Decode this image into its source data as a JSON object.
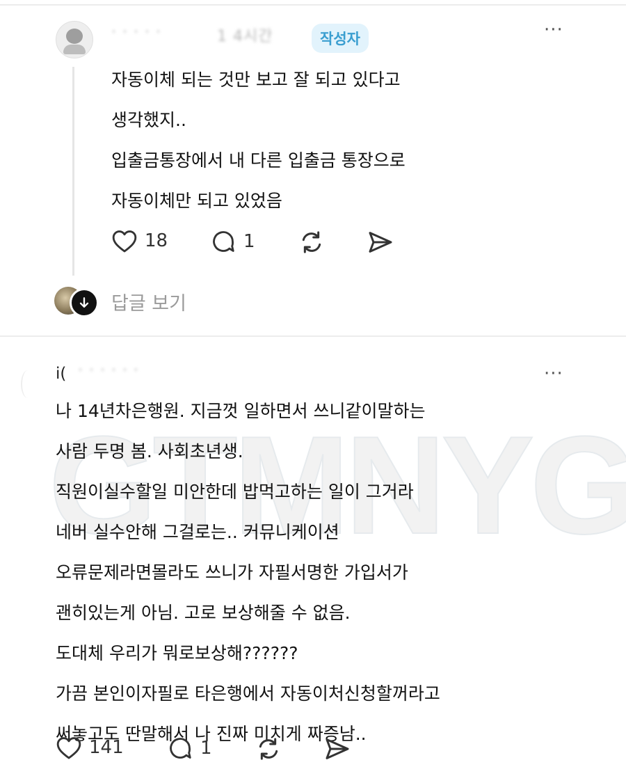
{
  "comment1": {
    "username": "·  · · · ·",
    "time": "1 4시간",
    "badge": "작성자",
    "more": "···",
    "lines": [
      "자동이체 되는 것만 보고 잘 되고 있다고",
      "생각했지..",
      "입출금통장에서 내 다른 입출금 통장으로",
      "자동이체만 되고 있었음"
    ],
    "likes": "18",
    "replies": "1",
    "view_replies": "답글 보기"
  },
  "comment2": {
    "username": "i(",
    "username_blur": "·  ·   ·  · ·  ·",
    "more": "···",
    "lines": [
      "나 14년차은행원.  지금껏 일하면서 쓰니같이말하는",
      "사람 두명 봄. 사회초년생.",
      "직원이실수할일 미안한데 밥먹고하는  일이 그거라",
      "네버 실수안해 그걸로는.. 커뮤니케이션",
      "오류문제라면몰라도 쓰니가 자필서명한 가입서가",
      "괜히있는게 아님. 고로 보상해줄 수 없음.",
      "도대체 우리가 뭐로보상해??????",
      "가끔 본인이자필로 타은행에서 자동이처신청할꺼라고",
      "써놓고도 딴말해서 나 진짜 미치게 짜증남.."
    ],
    "likes": "141",
    "replies": "1"
  },
  "watermark": "GTMNYG",
  "icons": [
    "heart-icon",
    "comment-icon",
    "repost-icon",
    "share-icon",
    "more-icon",
    "arrow-down-icon"
  ],
  "colors": {
    "badge_bg": "#e2f3fc",
    "badge_text": "#3a9ed0",
    "muted": "#9a9a9a"
  }
}
